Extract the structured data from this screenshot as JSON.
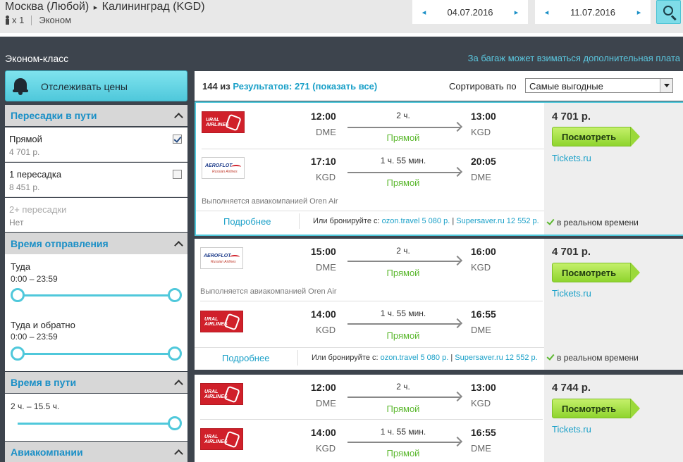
{
  "header": {
    "route_from": "Москва (Любой)",
    "route_arrow": "▸",
    "route_to": "Калининград (KGD)",
    "pax_count": "x 1",
    "cabin": "Эконом",
    "date_out": "04.07.2016",
    "date_back": "11.07.2016",
    "nav_prev": "◂",
    "nav_next": "▸"
  },
  "band": {
    "class_label": "Эконом-класс",
    "baggage_note": "За багаж может взиматься дополнительная плата"
  },
  "sidebar": {
    "track_label": "Отслеживать цены",
    "stops_title": "Пересадки в пути",
    "stops": [
      {
        "name": "Прямой",
        "price": "4 701 р.",
        "checked": true
      },
      {
        "name": "1 пересадка",
        "price": "8 451 р.",
        "checked": false
      },
      {
        "name": "2+ пересадки",
        "price": "Нет",
        "checked": false
      }
    ],
    "depart_title": "Время отправления",
    "depart_out_label": "Туда",
    "depart_out_range": "0:00 – 23:59",
    "depart_back_label": "Туда и обратно",
    "depart_back_range": "0:00 – 23:59",
    "duration_title": "Время в пути",
    "duration_range": "2 ч. – 15.5 ч.",
    "airlines_title": "Авиакомпании"
  },
  "results": {
    "count_prefix": "144 из",
    "count_link": "Результатов: 271 (показать все)",
    "sort_label": "Сортировать по",
    "sort_value": "Самые выгодные"
  },
  "cards": [
    {
      "price": "4 701 р.",
      "view_label": "Посмотреть",
      "agency": "Tickets.ru",
      "realtime": "в реальном времени",
      "more": "Подробнее",
      "alt_prefix": "Или бронируйте с:",
      "alt1": "ozon.travel 5 080 р.",
      "alt_sep": "|",
      "alt2": "Supersaver.ru 12 552 р.",
      "leg1": {
        "airline": "ural-airlines",
        "dep": "12:00",
        "dep_apt": "DME",
        "dur": "2 ч.",
        "stops": "Прямой",
        "arr": "13:00",
        "arr_apt": "KGD"
      },
      "leg2": {
        "airline": "aeroflot",
        "dep": "17:10",
        "dep_apt": "KGD",
        "dur": "1 ч. 55 мин.",
        "stops": "Прямой",
        "arr": "20:05",
        "arr_apt": "DME"
      },
      "operated": "Выполняется авиакомпанией Oren Air"
    },
    {
      "price": "4 701 р.",
      "view_label": "Посмотреть",
      "agency": "Tickets.ru",
      "realtime": "в реальном времени",
      "more": "Подробнее",
      "alt_prefix": "Или бронируйте с:",
      "alt1": "ozon.travel 5 080 р.",
      "alt_sep": "|",
      "alt2": "Supersaver.ru 12 552 р.",
      "leg1": {
        "airline": "aeroflot",
        "dep": "15:00",
        "dep_apt": "DME",
        "dur": "2 ч.",
        "stops": "Прямой",
        "arr": "16:00",
        "arr_apt": "KGD"
      },
      "operated": "Выполняется авиакомпанией Oren Air",
      "leg2": {
        "airline": "ural-airlines",
        "dep": "14:00",
        "dep_apt": "KGD",
        "dur": "1 ч. 55 мин.",
        "stops": "Прямой",
        "arr": "16:55",
        "arr_apt": "DME"
      }
    },
    {
      "price": "4 744 р.",
      "view_label": "Посмотреть",
      "agency": "Tickets.ru",
      "leg1": {
        "airline": "ural-airlines",
        "dep": "12:00",
        "dep_apt": "DME",
        "dur": "2 ч.",
        "stops": "Прямой",
        "arr": "13:00",
        "arr_apt": "KGD"
      },
      "leg2": {
        "airline": "ural-airlines",
        "dep": "14:00",
        "dep_apt": "KGD",
        "dur": "1 ч. 55 мин.",
        "stops": "Прямой",
        "arr": "16:55",
        "arr_apt": "DME"
      }
    }
  ],
  "logos": {
    "ural_text_1": "URAL",
    "ural_text_2": "AIRLINES",
    "aero_text": "AEROFLOT",
    "aero_sub": "Russian Airlines"
  },
  "colors": {
    "accent": "#1a8fc6",
    "teal": "#4fc8db",
    "green": "#5bb82e",
    "dark_band": "#3d444d"
  }
}
